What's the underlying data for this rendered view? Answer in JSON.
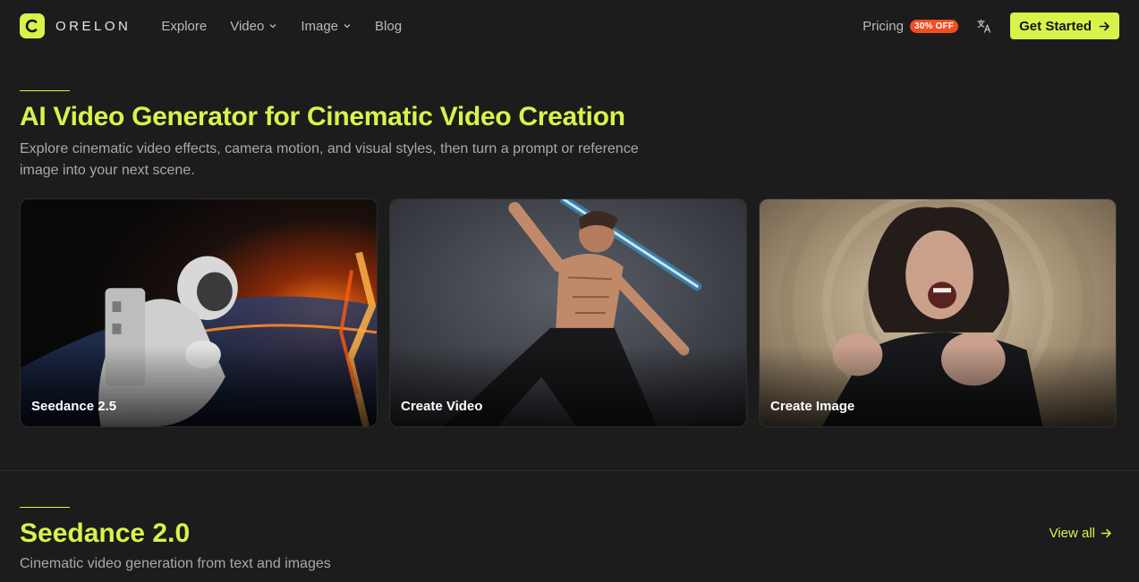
{
  "brand": {
    "name": "ORELON"
  },
  "nav": {
    "links": [
      {
        "label": "Explore"
      },
      {
        "label": "Video"
      },
      {
        "label": "Image"
      },
      {
        "label": "Blog"
      }
    ],
    "pricing_label": "Pricing",
    "pricing_badge": "30% OFF",
    "cta_label": "Get Started"
  },
  "hero": {
    "title": "AI Video Generator for Cinematic Video Creation",
    "subtitle": "Explore cinematic video effects, camera motion, and visual styles, then turn a prompt or reference image into your next scene."
  },
  "cards": [
    {
      "label": "Seedance 2.5"
    },
    {
      "label": "Create Video"
    },
    {
      "label": "Create Image"
    }
  ],
  "section": {
    "title": "Seedance 2.0",
    "subtitle": "Cinematic video generation from text and images",
    "view_all_label": "View all"
  },
  "colors": {
    "accent": "#d9f34a",
    "background": "#1c1c1c",
    "badge": "#f04e23"
  },
  "icons": {
    "logo": "logo-icon",
    "chevron": "chevron-down-icon",
    "language": "translate-icon",
    "arrow": "arrow-right-icon"
  }
}
